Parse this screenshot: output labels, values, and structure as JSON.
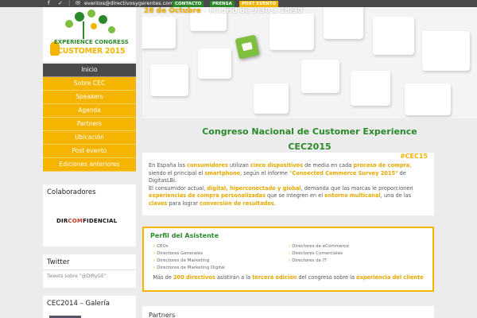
{
  "topbar": {
    "icons": [
      "facebook-icon",
      "twitter-icon",
      "linkedin-icon",
      "mail-icon"
    ],
    "fb_glyph": "f",
    "tw_glyph": "✓",
    "in_glyph": "|",
    "mail_glyph": "✉",
    "email": "eventos@directivosygerentes.com",
    "buttons": [
      {
        "label": "CONTACTO",
        "color": "#2a8a2a"
      },
      {
        "label": "PRENSA",
        "color": "#2a8a2a"
      },
      {
        "label": "POST EVENTO",
        "color": "#f5b400"
      }
    ]
  },
  "logo": {
    "line1": "EXPERIENCE CONGRESS",
    "line2": "CUSTOMER 2015"
  },
  "menu": [
    {
      "label": "Inicio",
      "active": true
    },
    {
      "label": "Sobre CEC"
    },
    {
      "label": "Speakers"
    },
    {
      "label": "Agenda"
    },
    {
      "label": "Partners"
    },
    {
      "label": "Ubicación"
    },
    {
      "label": "Post evento"
    },
    {
      "label": "Ediciones anteriores"
    }
  ],
  "widgets": {
    "colaboradores": "Colaboradores",
    "dir_a": "DIR",
    "dir_b": "COM",
    "dir_c": "FIDENCIAL",
    "twitter": "Twitter",
    "tweets": "Tweets sobre \"@DIRyGE\"",
    "galeria": "CEC2014 – Galería"
  },
  "hero": {
    "date_bold": "28 de Octubre",
    "date_rest": " - Madrid de 9:30 a 18:30"
  },
  "title": {
    "line1": "Congreso Nacional de Customer Experience",
    "line2": "CEC2015"
  },
  "intro": {
    "hashtag": "#CEC15",
    "p1": [
      {
        "t": "En España los "
      },
      {
        "t": "consumidores",
        "c": "y"
      },
      {
        "t": " utilizan "
      },
      {
        "t": "cinco dispositivos",
        "c": "y"
      },
      {
        "t": " de media en cada "
      },
      {
        "t": "proceso de compra",
        "c": "y"
      },
      {
        "t": ", siendo el principal el "
      },
      {
        "t": "smartphone",
        "c": "y"
      },
      {
        "t": ", según el informe "
      },
      {
        "t": "\"Connected Commerce Survey 2015\"",
        "c": "y"
      },
      {
        "t": " de DigitasLBi."
      }
    ],
    "p2": [
      {
        "t": "El consumidor actual, "
      },
      {
        "t": "digital, hiperconectado y global",
        "c": "y"
      },
      {
        "t": ", demanda que las marcas le proporcionen "
      },
      {
        "t": "experiencias de compra personalizadas",
        "c": "y"
      },
      {
        "t": " que se integren en el "
      },
      {
        "t": "entorno multicanal",
        "c": "y"
      },
      {
        "t": ", una de las "
      },
      {
        "t": "claves",
        "c": "y"
      },
      {
        "t": " para lograr "
      },
      {
        "t": "conversión de resultados",
        "c": "y"
      },
      {
        "t": "."
      }
    ]
  },
  "perfil": {
    "title": "Perfil del Asistente",
    "left": [
      "CEOs",
      "Directores Generales",
      "Directores de Marketing",
      "Directores de Marketing Digital"
    ],
    "right": [
      "Directores de eCommerce",
      "Directores Comerciales",
      "Directores de IT"
    ],
    "bottom": [
      {
        "t": "Más de "
      },
      {
        "t": "200 directivos",
        "c": "y"
      },
      {
        "t": " asistirán a la "
      },
      {
        "t": "tercera edición",
        "c": "y"
      },
      {
        "t": " del congreso sobre la "
      },
      {
        "t": "experiencia del cliente",
        "c": "y"
      }
    ]
  },
  "partners": "Partners"
}
